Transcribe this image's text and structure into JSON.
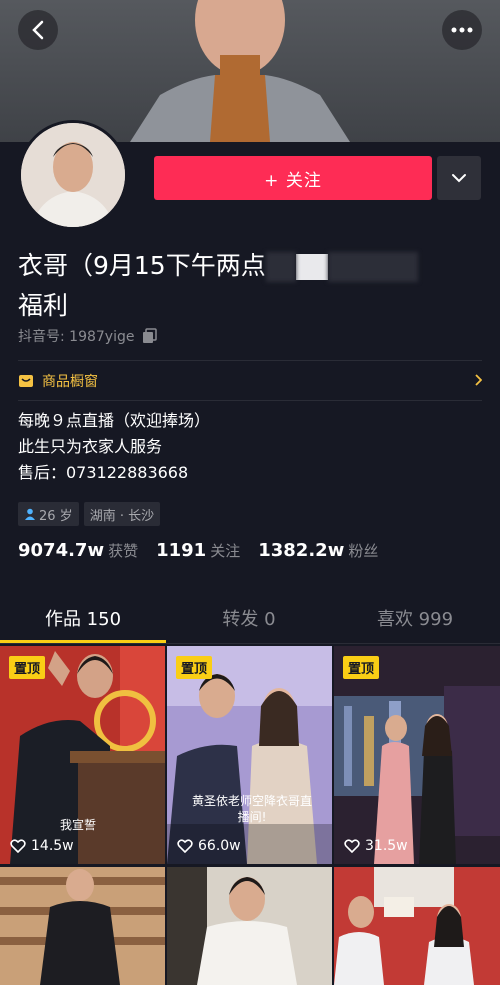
{
  "header": {
    "back_icon": "back-arrow-icon",
    "more_icon": "more-dots-icon"
  },
  "profile": {
    "follow_label": "+ 关注",
    "nickname_line1": "衣哥（9月15下午两点",
    "nickname_line2": "福利",
    "douyin_id": "抖音号: 1987yige",
    "shop_label": "商品橱窗",
    "bio": [
      "每晚９点直播（欢迎捧场）",
      "此生只为衣家人服务",
      "售后：073122883668"
    ],
    "age_tag": "26 岁",
    "location_tag": "湖南 · 长沙"
  },
  "stats": [
    {
      "value": "9074.7w",
      "label": "获赞"
    },
    {
      "value": "1191",
      "label": "关注"
    },
    {
      "value": "1382.2w",
      "label": "粉丝"
    }
  ],
  "tabs": [
    {
      "label": "作品 150"
    },
    {
      "label": "转发 0"
    },
    {
      "label": "喜欢 999"
    }
  ],
  "videos": [
    {
      "pin": "置顶",
      "likes": "14.5w",
      "caption": "我宣誓"
    },
    {
      "pin": "置顶",
      "likes": "66.0w",
      "caption": "黄圣依老师空降衣哥直播间!"
    },
    {
      "pin": "置顶",
      "likes": "31.5w",
      "caption": ""
    }
  ],
  "colors": {
    "background": "#161823",
    "accent": "#fe2c55",
    "pin": "#face15",
    "shop": "#f5c243"
  }
}
